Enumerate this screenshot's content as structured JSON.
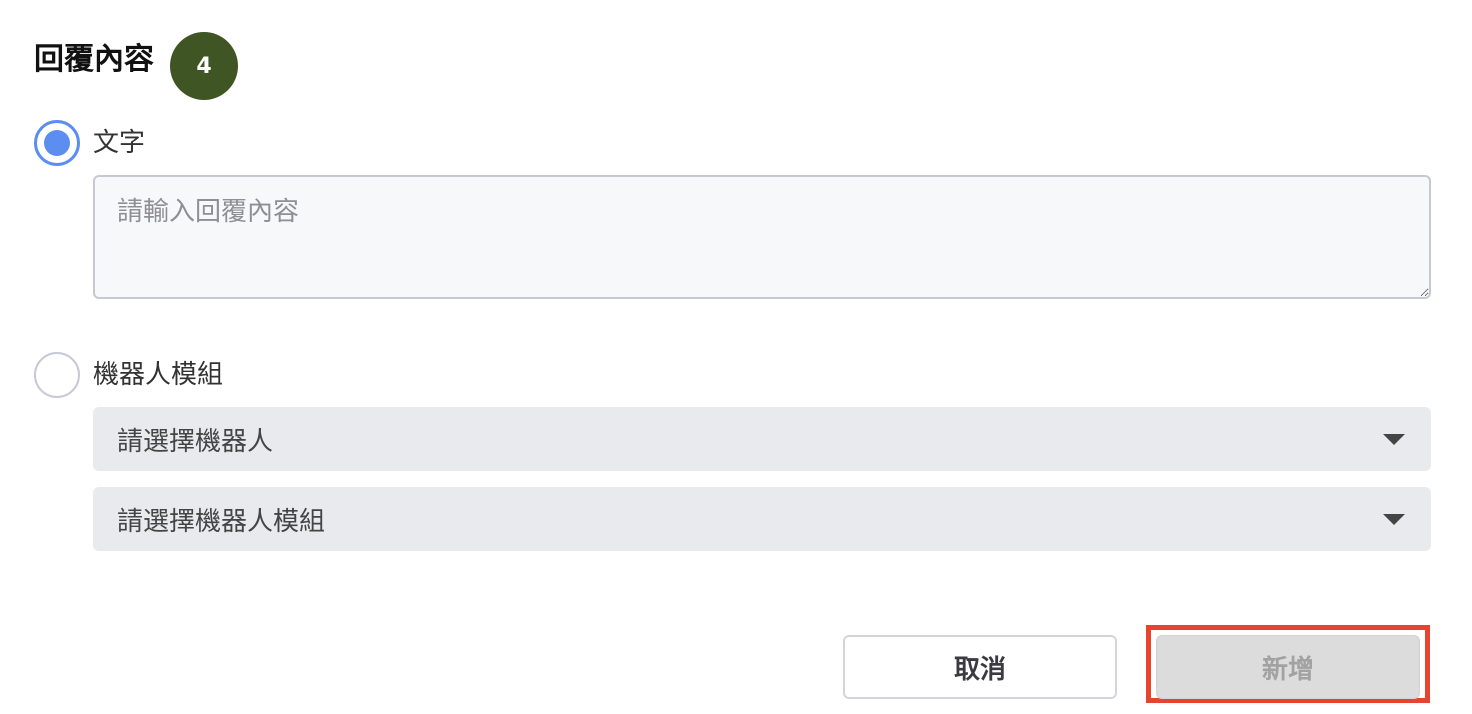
{
  "section": {
    "title": "回覆內容",
    "step_badge": "4"
  },
  "options": {
    "text": {
      "label": "文字",
      "selected": true,
      "placeholder": "請輸入回覆內容",
      "value": ""
    },
    "bot_module": {
      "label": "機器人模組",
      "selected": false,
      "bot_select": "請選擇機器人",
      "module_select": "請選擇機器人模組"
    }
  },
  "actions": {
    "cancel": "取消",
    "add": "新增"
  },
  "colors": {
    "badge": "#3f5523",
    "radio_selected": "#5b8ef0",
    "highlight": "#e8432f"
  },
  "icons": {
    "dropdown": "caret-down-icon"
  }
}
